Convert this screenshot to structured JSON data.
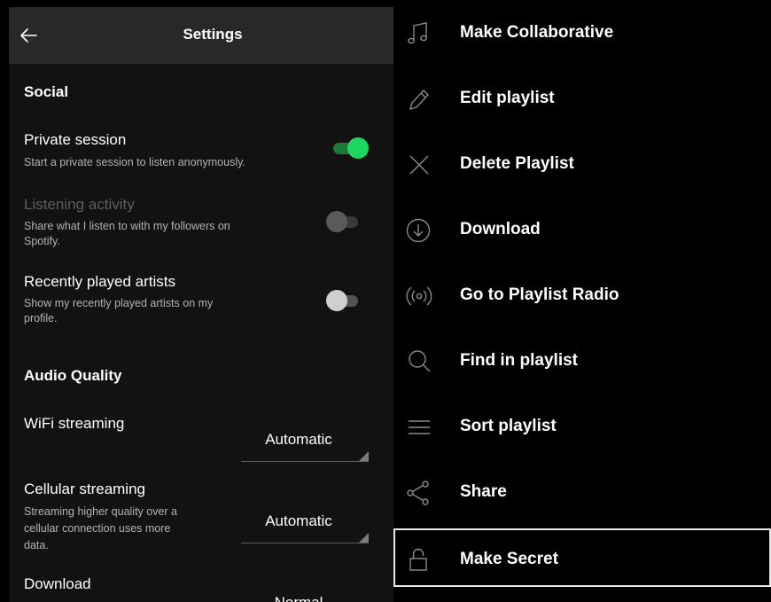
{
  "settings": {
    "title": "Settings",
    "social": {
      "heading": "Social",
      "private_session": {
        "title": "Private session",
        "desc": "Start a private session to listen anonymously.",
        "enabled": true
      },
      "listening_activity": {
        "title": "Listening activity",
        "desc_1": "Share what I listen to with my followers on",
        "desc_2": "Spotify.",
        "enabled": false,
        "disabled": true
      },
      "recently_played": {
        "title": "Recently played artists",
        "desc_1": "Show my recently played artists on my",
        "desc_2": "profile.",
        "enabled": false
      }
    },
    "audio": {
      "heading": "Audio Quality",
      "wifi": {
        "title": "WiFi streaming",
        "value": "Automatic"
      },
      "cellular": {
        "title": "Cellular streaming",
        "desc_1": "Streaming higher quality over a",
        "desc_2": "cellular connection uses more",
        "desc_3": "data.",
        "value": "Automatic"
      },
      "download": {
        "title": "Download",
        "value": "Normal"
      }
    },
    "accent_color": "#1ed760"
  },
  "menu": {
    "items": [
      {
        "label": "Make Collaborative",
        "icon": "music-note-icon"
      },
      {
        "label": "Edit playlist",
        "icon": "pencil-icon"
      },
      {
        "label": "Delete Playlist",
        "icon": "close-icon"
      },
      {
        "label": "Download",
        "icon": "download-icon"
      },
      {
        "label": "Go to Playlist Radio",
        "icon": "radio-icon"
      },
      {
        "label": "Find in playlist",
        "icon": "search-icon"
      },
      {
        "label": "Sort playlist",
        "icon": "sort-icon"
      },
      {
        "label": "Share",
        "icon": "share-icon"
      },
      {
        "label": "Make Secret",
        "icon": "lock-icon",
        "selected": true
      }
    ]
  }
}
